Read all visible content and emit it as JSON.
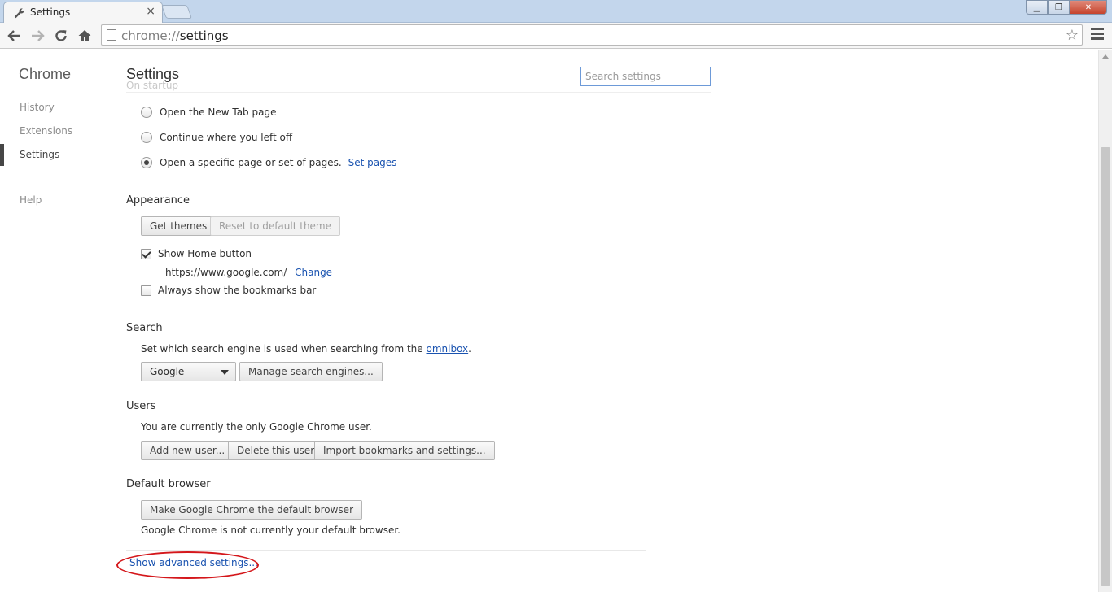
{
  "browser": {
    "tab_title": "Settings",
    "tab_close": "×",
    "url_scheme": "chrome://",
    "url_path": "settings",
    "window_minimize": "▁",
    "window_restore": "❐",
    "window_close": "✕",
    "star": "☆"
  },
  "nav": {
    "title": "Chrome",
    "items": [
      {
        "label": "History"
      },
      {
        "label": "Extensions"
      },
      {
        "label": "Settings"
      },
      {
        "label": "Help"
      }
    ]
  },
  "main": {
    "title": "Settings",
    "ghost_heading": "On startup",
    "search_placeholder": "Search settings",
    "startup": {
      "options": [
        {
          "label": "Open the New Tab page",
          "checked": false
        },
        {
          "label": "Continue where you left off",
          "checked": false
        },
        {
          "label": "Open a specific page or set of pages.",
          "checked": true
        }
      ],
      "set_pages_link": "Set pages"
    },
    "appearance": {
      "title": "Appearance",
      "get_themes": "Get themes",
      "reset_theme": "Reset to default theme",
      "show_home_button": "Show Home button",
      "home_url": "https://www.google.com/",
      "change_link": "Change",
      "bookmarks_bar": "Always show the bookmarks bar"
    },
    "search": {
      "title": "Search",
      "description_prefix": "Set which search engine is used when searching from the",
      "omnibox_link": "omnibox",
      "description_suffix": ".",
      "engine": "Google",
      "manage": "Manage search engines..."
    },
    "users": {
      "title": "Users",
      "description": "You are currently the only Google Chrome user.",
      "add": "Add new user...",
      "delete": "Delete this user",
      "import": "Import bookmarks and settings..."
    },
    "default_browser": {
      "title": "Default browser",
      "make_default": "Make Google Chrome the default browser",
      "status": "Google Chrome is not currently your default browser."
    },
    "advanced_link": "Show advanced settings..."
  }
}
